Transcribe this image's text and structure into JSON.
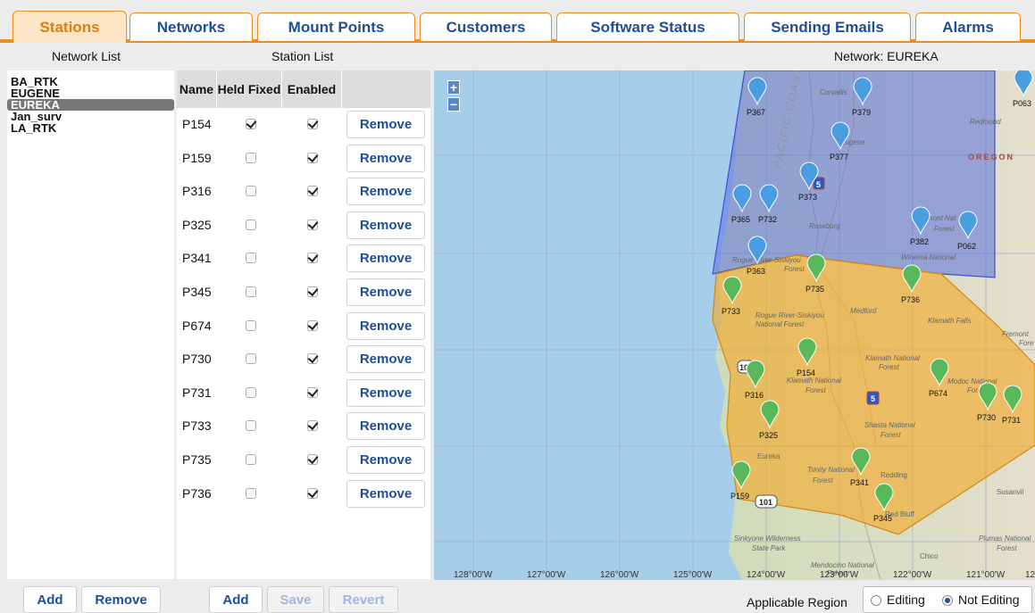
{
  "tabs": [
    {
      "label": "Stations",
      "active": true
    },
    {
      "label": "Networks",
      "active": false
    },
    {
      "label": "Mount Points",
      "active": false
    },
    {
      "label": "Customers",
      "active": false
    },
    {
      "label": "Software Status",
      "active": false
    },
    {
      "label": "Sending Emails",
      "active": false
    },
    {
      "label": "Alarms",
      "active": false
    }
  ],
  "headers": {
    "network_list": "Network List",
    "station_list": "Station List",
    "network_title": "Network: EUREKA"
  },
  "networks": [
    "BA_RTK",
    "EUGENE",
    "EUREKA",
    "Jan_surv",
    "LA_RTK"
  ],
  "selected_network": "EUREKA",
  "station_columns": {
    "name": "Name",
    "held_fixed": "Held Fixed",
    "enabled": "Enabled"
  },
  "stations": [
    {
      "name": "P154",
      "held_fixed": true,
      "enabled": true
    },
    {
      "name": "P159",
      "held_fixed": false,
      "enabled": true
    },
    {
      "name": "P316",
      "held_fixed": false,
      "enabled": true
    },
    {
      "name": "P325",
      "held_fixed": false,
      "enabled": true
    },
    {
      "name": "P341",
      "held_fixed": false,
      "enabled": true
    },
    {
      "name": "P345",
      "held_fixed": false,
      "enabled": true
    },
    {
      "name": "P674",
      "held_fixed": false,
      "enabled": true
    },
    {
      "name": "P730",
      "held_fixed": false,
      "enabled": true
    },
    {
      "name": "P731",
      "held_fixed": false,
      "enabled": true
    },
    {
      "name": "P733",
      "held_fixed": false,
      "enabled": true
    },
    {
      "name": "P735",
      "held_fixed": false,
      "enabled": true
    },
    {
      "name": "P736",
      "held_fixed": false,
      "enabled": true
    }
  ],
  "remove_label": "Remove",
  "bottom": {
    "net_add": "Add",
    "net_remove": "Remove",
    "st_add": "Add",
    "st_save": "Save",
    "st_revert": "Revert",
    "region_label": "Applicable Region",
    "editing": "Editing",
    "not_editing": "Not Editing",
    "mode": "not_editing"
  },
  "map": {
    "zoom_in": "+",
    "zoom_out": "−",
    "longitudes": [
      "128°00'W",
      "127°00'W",
      "126°00'W",
      "125°00'W",
      "124°00'W",
      "123°00'W",
      "122°00'W",
      "121°00'W",
      "12"
    ],
    "place_labels": [
      "Corvallis",
      "Redmond",
      "OREGON",
      "Eugene",
      "Roseburg",
      "Fremont Nat",
      "Forest",
      "Rogue River-Siskiyou",
      "Forest",
      "Winema National",
      "Rogue River-Siskiyou",
      "National Forest",
      "Medford",
      "Klamath Falls",
      "Fremont",
      "Fore",
      "Klamath National",
      "Forest",
      "Klamath National",
      "Forest",
      "Modoc National",
      "Fore",
      "Shasta National",
      "Forest",
      "Eureka",
      "Trinity National",
      "Forest",
      "Redding",
      "Susanvil",
      "Red Bluff",
      "Sinkyone Wilderness",
      "State Park",
      "Mendocino National",
      "Forest",
      "Chico",
      "Plumas National",
      "Forest",
      "PACIFIC COAST RANGE",
      "5",
      "5",
      "101",
      "101"
    ],
    "marker_colors": {
      "network": "#4a9de0",
      "station": "#58b85a"
    },
    "region_colors": {
      "network": "#5a6fe0",
      "station": "#f5a623"
    },
    "network_markers": [
      "P367",
      "P379",
      "P377",
      "P373",
      "P365",
      "P732",
      "P382",
      "P062",
      "P363",
      "P063"
    ],
    "station_markers": [
      "P733",
      "P735",
      "P736",
      "P154",
      "P316",
      "P674",
      "P730",
      "P731",
      "P325",
      "P341",
      "P159",
      "P345"
    ]
  }
}
